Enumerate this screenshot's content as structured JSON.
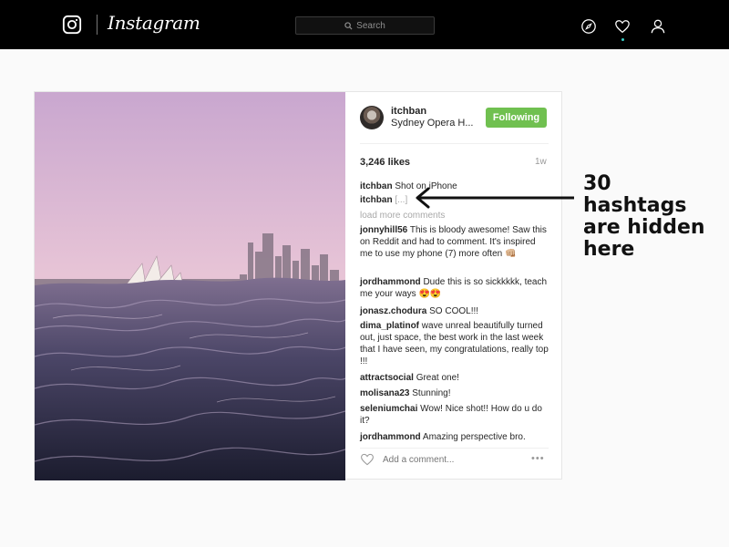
{
  "topbar": {
    "logo_text": "Instagram",
    "search_placeholder": "Search",
    "icons": [
      "instagram-camera-icon",
      "search-icon",
      "compass-icon",
      "heart-icon",
      "profile-icon"
    ],
    "accent_dot_color": "#3ad0c8"
  },
  "post": {
    "username": "itchban",
    "location": "Sydney Opera H...",
    "follow_label": "Following",
    "follow_color": "#70c050",
    "likes": "3,246 likes",
    "time": "1w",
    "caption": {
      "user": "itchban",
      "text": "Shot on iPhone"
    },
    "hidden_tags": {
      "user": "itchban",
      "text": "[...]"
    },
    "load_more": "load more comments",
    "comments": [
      {
        "user": "jonnyhill56",
        "text": "This is bloody awesome! Saw this on Reddit and had to comment. It's inspired me to use my phone (7) more often 👊🏼"
      },
      {
        "user": "jordhammond",
        "text": "Dude this is so sickkkkk, teach me your ways 😍😍"
      },
      {
        "user": "jonasz.chodura",
        "text": "SO COOL!!!"
      },
      {
        "user": "dima_platinof",
        "text": "wave unreal beautifully turned out, just space, the best work in the last week that I have seen, my congratulations, really top !!!"
      },
      {
        "user": "attractsocial",
        "text": "Great one!"
      },
      {
        "user": "molisana23",
        "text": "Stunning!"
      },
      {
        "user": "seleniumchai",
        "text": "Wow! Nice shot!! How do u do it?"
      },
      {
        "user": "jordhammond",
        "text": "Amazing perspective bro."
      }
    ],
    "add_comment_placeholder": "Add a comment...",
    "more_label": "•••"
  },
  "annotation": {
    "line1": "30 hashtags",
    "line2": "are hidden",
    "line3": "here"
  }
}
